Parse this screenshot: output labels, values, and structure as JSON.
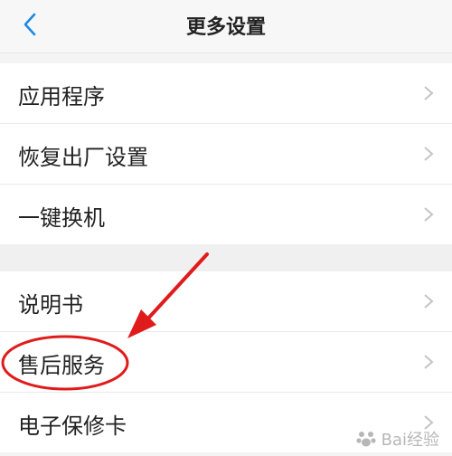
{
  "header": {
    "title": "更多设置",
    "back_icon": "chevron-left-icon",
    "accent": "#1e88e5"
  },
  "groups": [
    {
      "items": [
        {
          "label": "应用程序"
        },
        {
          "label": "恢复出厂设置"
        },
        {
          "label": "一键换机"
        }
      ]
    },
    {
      "items": [
        {
          "label": "说明书"
        },
        {
          "label": "售后服务"
        },
        {
          "label": "电子保修卡"
        }
      ]
    }
  ],
  "annotation": {
    "color": "#e01b1b",
    "highlighted_item": "售后服务"
  },
  "watermark": {
    "text": "Bai经验"
  }
}
